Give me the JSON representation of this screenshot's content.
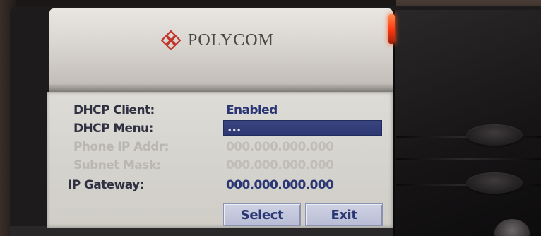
{
  "brand": {
    "logo_text": "POLYCOM",
    "logo_color": "#c0352a"
  },
  "screen": {
    "rows": [
      {
        "label": "DHCP Client:",
        "value": "Enabled",
        "state": "active"
      },
      {
        "label": "DHCP Menu:",
        "value": "...",
        "state": "selected"
      },
      {
        "label": "Phone IP Addr:",
        "value": "000.000.000.000",
        "state": "disabled"
      },
      {
        "label": "Subnet Mask:",
        "value": "000.000.000.000",
        "state": "disabled"
      },
      {
        "label": "IP Gateway:",
        "value": "000.000.000.000",
        "state": "active"
      }
    ],
    "softkeys": {
      "select": "Select",
      "exit": "Exit"
    }
  },
  "indicators": {
    "led_color": "#ff3a12"
  }
}
